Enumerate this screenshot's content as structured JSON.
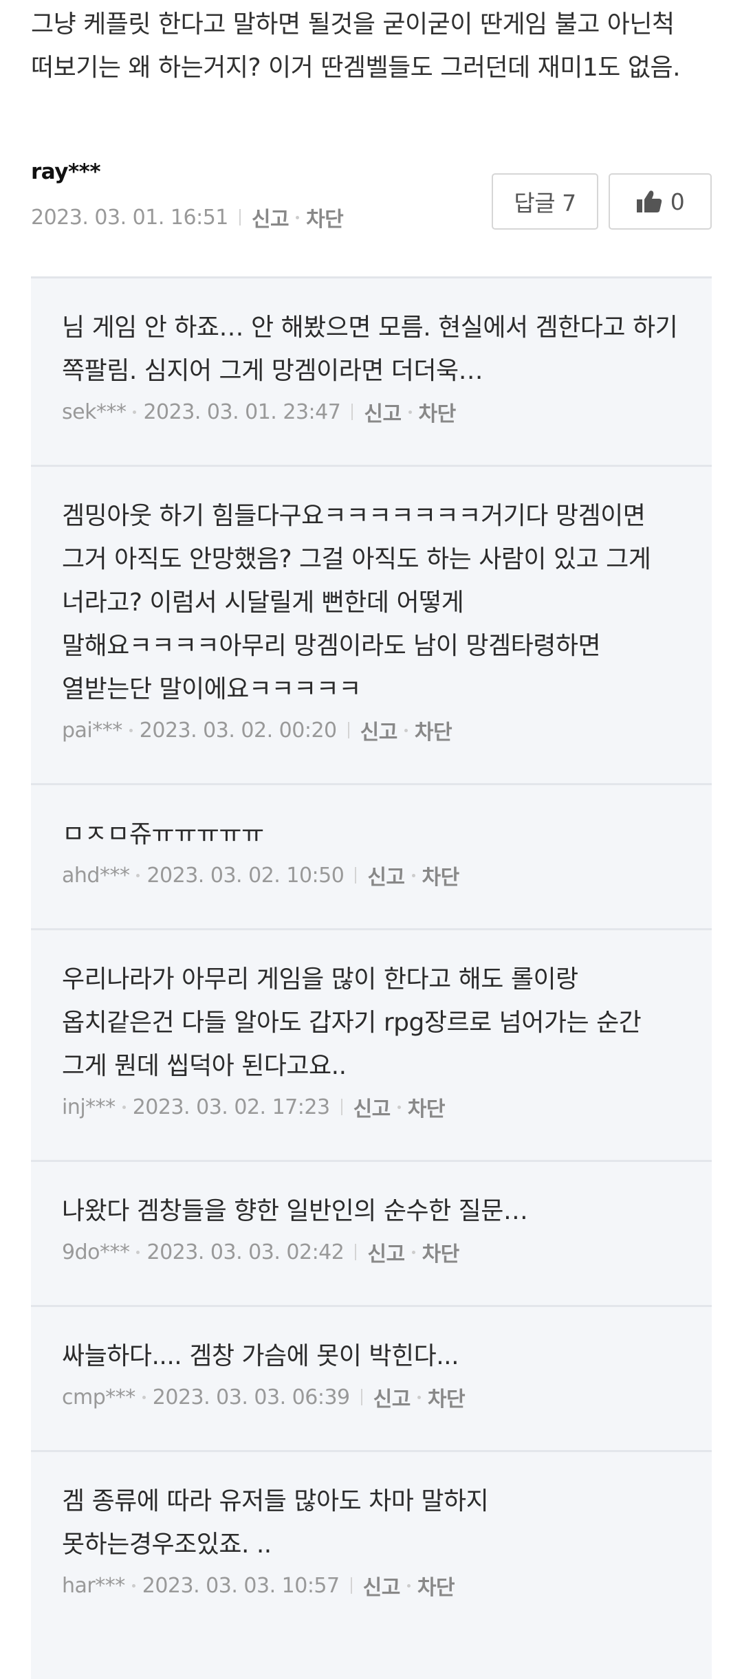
{
  "main_comment": {
    "text": "그냥 케플릿 한다고 말하면 될것을 굳이굳이 딴게임 불고 아닌척 떠보기는 왜 하는거지? 이거 딴겜벨들도 그러던데 재미1도 없음.",
    "author": "ray***",
    "timestamp": "2023. 03. 01. 16:51",
    "report_label": "신고",
    "block_label": "차단",
    "reply_label": "답글 7",
    "like_count": "0",
    "like_icon": "thumbs-up-icon"
  },
  "replies": [
    {
      "text": "님 게임 안 하죠… 안 해봤으면 모름. 현실에서 겜한다고 하기 쪽팔림. 심지어 그게 망겜이라면 더더욱…",
      "author": "sek***",
      "timestamp": "2023. 03. 01. 23:47",
      "report_label": "신고",
      "block_label": "차단"
    },
    {
      "text": "겜밍아웃 하기 힘들다구요ㅋㅋㅋㅋㅋㅋㅋ거기다 망겜이면 그거 아직도 안망했음? 그걸 아직도 하는 사람이 있고 그게 너라고? 이럼서 시달릴게 뻔한데 어떻게 말해요ㅋㅋㅋㅋ아무리 망겜이라도 남이 망겜타령하면 열받는단 말이에요ㅋㅋㅋㅋㅋ",
      "author": "pai***",
      "timestamp": "2023. 03. 02. 00:20",
      "report_label": "신고",
      "block_label": "차단"
    },
    {
      "text": "ㅁㅈㅁ쥬ㅠㅠㅠㅠㅠ",
      "author": "ahd***",
      "timestamp": "2023. 03. 02. 10:50",
      "report_label": "신고",
      "block_label": "차단"
    },
    {
      "text": "우리나라가 아무리 게임을 많이 한다고 해도 롤이랑 옵치같은건 다들 알아도 갑자기 rpg장르로 넘어가는 순간 그게 뭔데 씹덕아 된다고요..",
      "author": "inj***",
      "timestamp": "2023. 03. 02. 17:23",
      "report_label": "신고",
      "block_label": "차단"
    },
    {
      "text": "나왔다 겜창들을 향한 일반인의 순수한 질문…",
      "author": "9do***",
      "timestamp": "2023. 03. 03. 02:42",
      "report_label": "신고",
      "block_label": "차단"
    },
    {
      "text": "싸늘하다.... 겜창 가슴에 못이 박힌다...",
      "author": "cmp***",
      "timestamp": "2023. 03. 03. 06:39",
      "report_label": "신고",
      "block_label": "차단"
    },
    {
      "text": "겜 종류에 따라 유저들 많아도 차마 말하지 못하는경우조있죠. ..",
      "author": "har***",
      "timestamp": "2023. 03. 03. 10:57",
      "report_label": "신고",
      "block_label": "차단"
    }
  ]
}
